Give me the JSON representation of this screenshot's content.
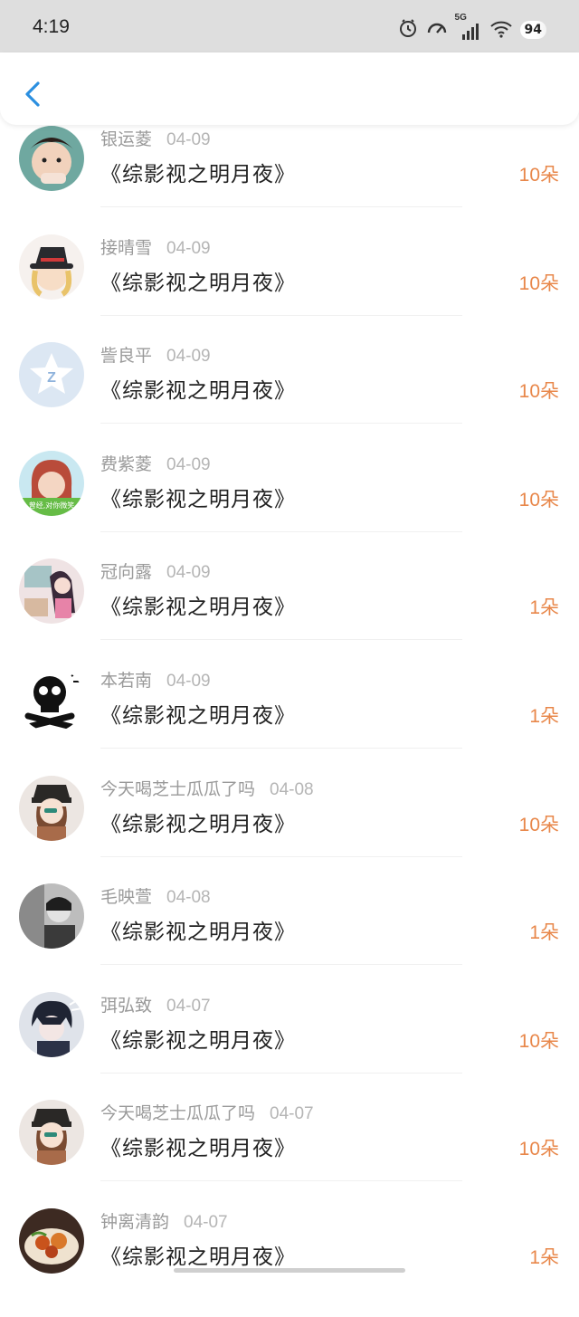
{
  "status": {
    "time": "4:19",
    "network": "5G",
    "battery": "94"
  },
  "header": {
    "back_icon": "chevron-left-icon"
  },
  "items": [
    {
      "name": "银运菱",
      "date": "04-09",
      "title": "《综影视之明月夜》",
      "amount": "10朵",
      "avatar": "photo-boy"
    },
    {
      "name": "接晴雪",
      "date": "04-09",
      "title": "《综影视之明月夜》",
      "amount": "10朵",
      "avatar": "anime-hat"
    },
    {
      "name": "訾良平",
      "date": "04-09",
      "title": "《综影视之明月夜》",
      "amount": "10朵",
      "avatar": "default-qq"
    },
    {
      "name": "费紫菱",
      "date": "04-09",
      "title": "《综影视之明月夜》",
      "amount": "10朵",
      "avatar": "photo-girl"
    },
    {
      "name": "冠向露",
      "date": "04-09",
      "title": "《综影视之明月夜》",
      "amount": "1朵",
      "avatar": "anime-girl"
    },
    {
      "name": "本若南",
      "date": "04-09",
      "title": "《综影视之明月夜》",
      "amount": "1朵",
      "avatar": "skull"
    },
    {
      "name": "今天喝芝士瓜瓜了吗",
      "date": "04-08",
      "title": "《综影视之明月夜》",
      "amount": "10朵",
      "avatar": "anime-beret"
    },
    {
      "name": "毛映萱",
      "date": "04-08",
      "title": "《综影视之明月夜》",
      "amount": "1朵",
      "avatar": "photo-bw"
    },
    {
      "name": "弭弘致",
      "date": "04-07",
      "title": "《综影视之明月夜》",
      "amount": "10朵",
      "avatar": "anime-boy"
    },
    {
      "name": "今天喝芝士瓜瓜了吗",
      "date": "04-07",
      "title": "《综影视之明月夜》",
      "amount": "10朵",
      "avatar": "anime-beret"
    },
    {
      "name": "钟离清韵",
      "date": "04-07",
      "title": "《综影视之明月夜》",
      "amount": "1朵",
      "avatar": "photo-food"
    }
  ],
  "colors": {
    "accent": "#e8874a",
    "back": "#2b8fe0"
  }
}
